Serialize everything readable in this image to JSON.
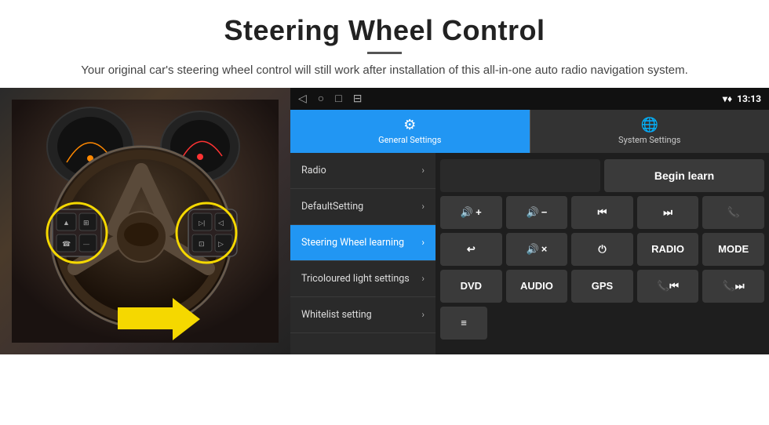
{
  "header": {
    "title": "Steering Wheel Control",
    "subtitle": "Your original car's steering wheel control will still work after installation of this all-in-one auto radio navigation system."
  },
  "statusBar": {
    "navBack": "◁",
    "navHome": "○",
    "navRecent": "□",
    "navMenu": "⊟",
    "time": "13:13"
  },
  "tabs": [
    {
      "label": "General Settings",
      "icon": "⚙",
      "active": true
    },
    {
      "label": "System Settings",
      "icon": "🌐",
      "active": false
    }
  ],
  "menu": {
    "items": [
      {
        "label": "Radio",
        "active": false
      },
      {
        "label": "DefaultSetting",
        "active": false
      },
      {
        "label": "Steering Wheel learning",
        "active": true
      },
      {
        "label": "Tricoloured light settings",
        "active": false
      },
      {
        "label": "Whitelist setting",
        "active": false
      }
    ]
  },
  "controls": {
    "beginLearn": "Begin learn",
    "row1": [
      "🔊+",
      "🔊−",
      "⏮",
      "⏭",
      "📞"
    ],
    "row2": [
      "↩",
      "🔊×",
      "⏻",
      "RADIO",
      "MODE"
    ],
    "row3": [
      "DVD",
      "AUDIO",
      "GPS",
      "📞⏮",
      "📞⏭"
    ],
    "row4_icon": "≡"
  }
}
